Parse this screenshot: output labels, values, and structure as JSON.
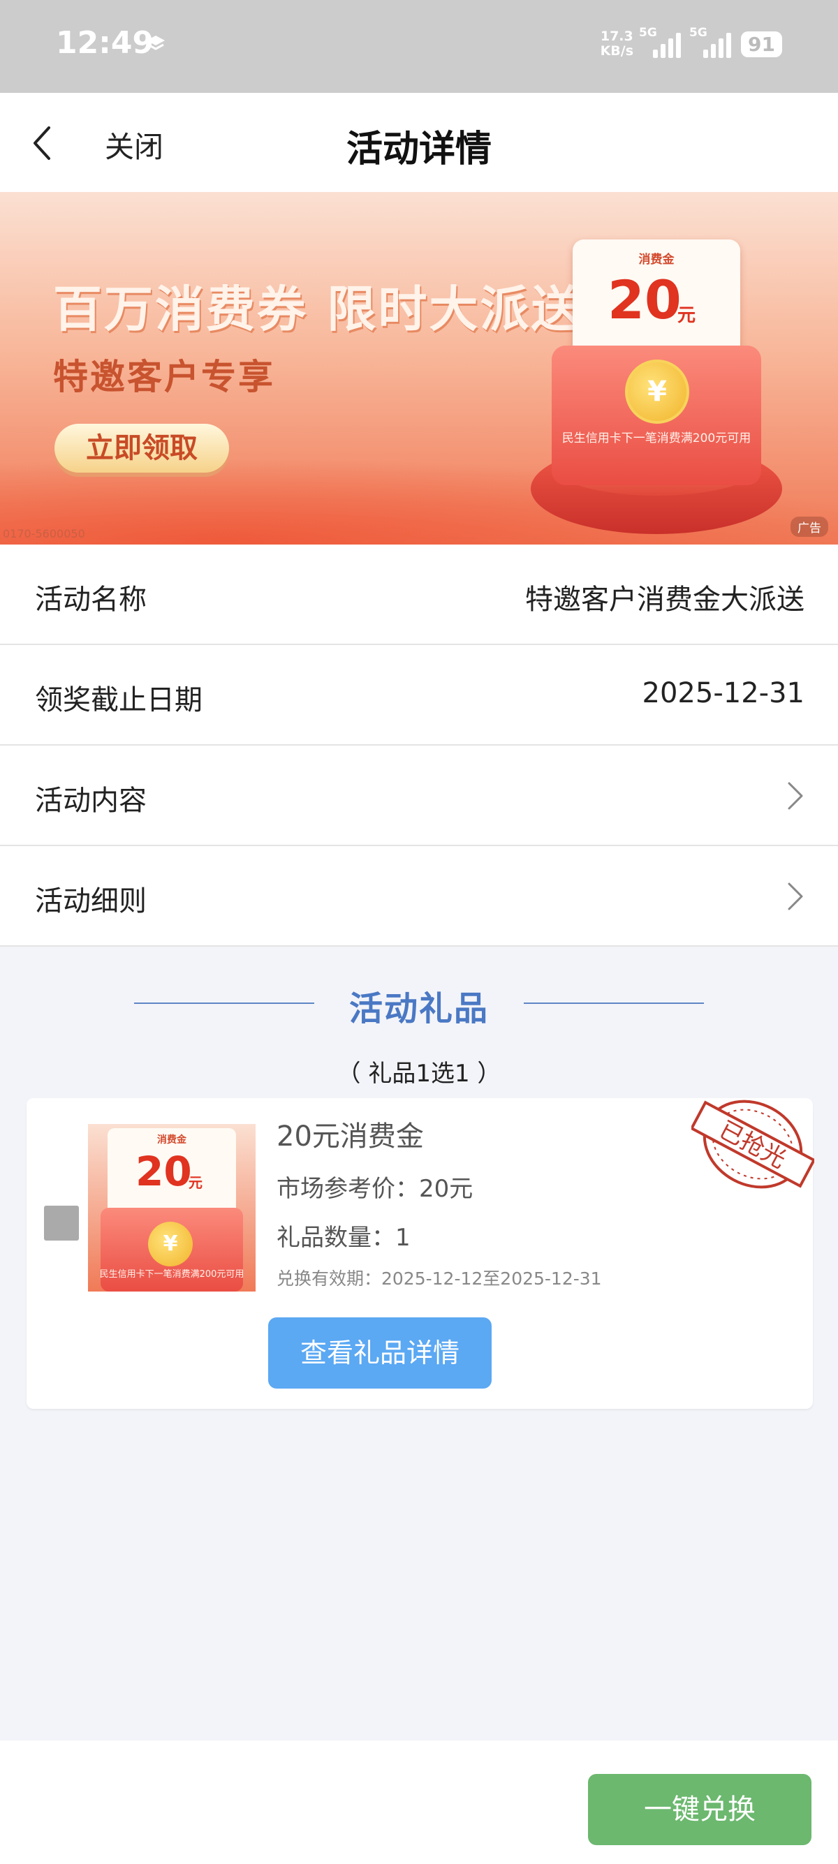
{
  "status_bar": {
    "time": "12:49",
    "net_speed_value": "17.3",
    "net_speed_unit": "KB/s",
    "sim1": "5G",
    "sim2": "5G",
    "battery": "91"
  },
  "nav": {
    "close_label": "关闭",
    "title": "活动详情"
  },
  "banner": {
    "headline": "百万消费券 限时大派送",
    "subline": "特邀客户专享",
    "cta": "立即领取",
    "voucher_tag": "消费金",
    "voucher_amount": "20",
    "voucher_unit": "元",
    "coin_symbol": "¥",
    "envelope_text": "民生信用卡下一笔消费满200元可用",
    "ad_badge": "广告",
    "code": "0170-5600050"
  },
  "info": {
    "name_label": "活动名称",
    "name_value": "特邀客户消费金大派送",
    "deadline_label": "领奖截止日期",
    "deadline_value": "2025-12-31",
    "content_label": "活动内容",
    "rules_label": "活动细则"
  },
  "gifts": {
    "section_title": "活动礼品",
    "subtitle": "（ 礼品1选1 ）",
    "item": {
      "name": "20元消费金",
      "price": "市场参考价：20元",
      "quantity": "礼品数量：1",
      "validity": "兑换有效期：2025-12-12至2025-12-31",
      "detail_button": "查看礼品详情",
      "stamp_text": "已抢光",
      "image_tag": "消费金",
      "image_amount": "20",
      "image_unit": "元",
      "image_text": "民生信用卡下一笔消费满200元可用"
    }
  },
  "bottom": {
    "redeem_button": "一键兑换"
  },
  "colors": {
    "accent_blue": "#4a78c4",
    "detail_button": "#5ba8f3",
    "redeem_button": "#6bb86e",
    "stamp_red": "#c0392b"
  }
}
